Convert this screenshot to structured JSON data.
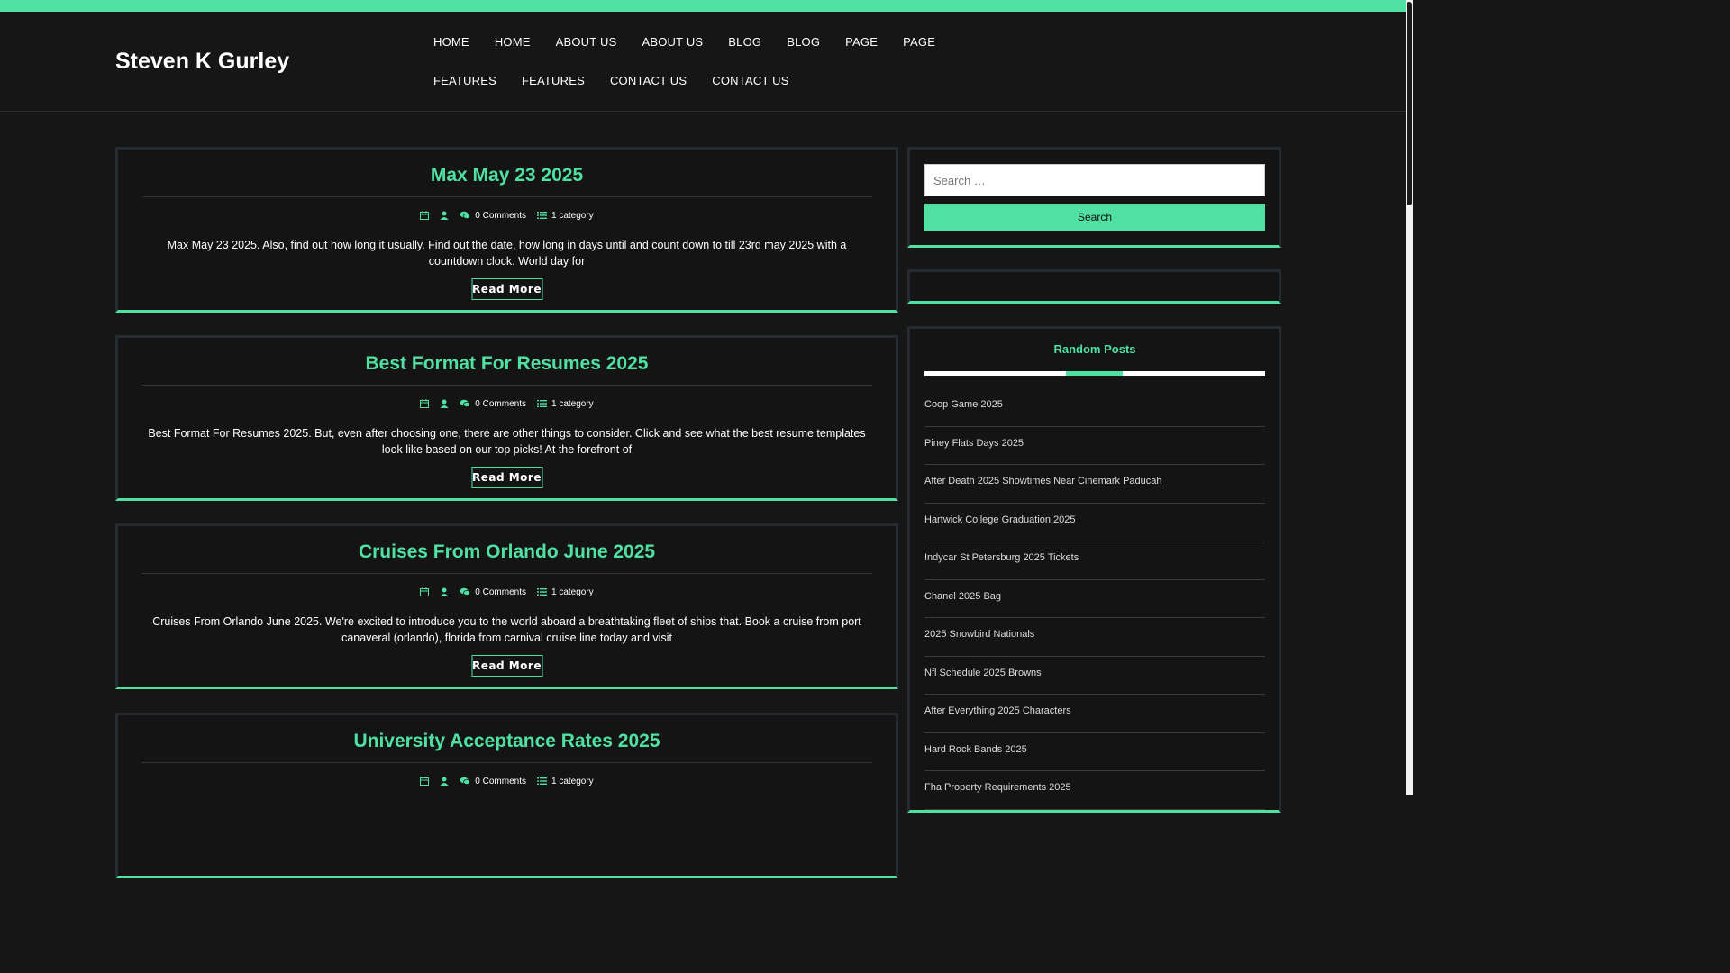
{
  "site": {
    "title": "Steven K Gurley"
  },
  "nav": {
    "items": [
      {
        "label": "HOME"
      },
      {
        "label": "HOME"
      },
      {
        "label": "ABOUT US"
      },
      {
        "label": "ABOUT US"
      },
      {
        "label": "BLOG"
      },
      {
        "label": "BLOG"
      },
      {
        "label": "PAGE"
      },
      {
        "label": "PAGE"
      },
      {
        "label": "FEATURES"
      },
      {
        "label": "FEATURES"
      },
      {
        "label": "CONTACT US"
      },
      {
        "label": "CONTACT US"
      }
    ]
  },
  "posts": [
    {
      "title": "Max May 23 2025",
      "comments": "0 Comments",
      "category": "1 category",
      "excerpt": "Max May 23 2025. Also, find out how long it usually. Find out the date, how long in days until and count down to till 23rd may 2025 with a countdown clock. World day for",
      "read_more": "Read More"
    },
    {
      "title": "Best Format For Resumes 2025",
      "comments": "0 Comments",
      "category": "1 category",
      "excerpt": "Best Format For Resumes 2025. But, even after choosing one, there are other things to consider. Click and see what the best resume templates look like based on our top picks! At the forefront of",
      "read_more": "Read More"
    },
    {
      "title": "Cruises From Orlando June 2025",
      "comments": "0 Comments",
      "category": "1 category",
      "excerpt": "Cruises From Orlando June 2025. We're excited to introduce you to the world aboard a breathtaking fleet of ships that. Book a cruise from port canaveral (orlando), florida from carnival cruise line today and visit",
      "read_more": "Read More"
    },
    {
      "title": "University Acceptance Rates 2025",
      "comments": "0 Comments",
      "category": "1 category",
      "excerpt": "",
      "read_more": ""
    }
  ],
  "sidebar": {
    "search": {
      "placeholder": "Search …",
      "button_label": "Search"
    },
    "random_posts": {
      "title": "Random Posts",
      "items": [
        "Coop Game 2025",
        "Piney Flats Days 2025",
        "After Death 2025 Showtimes Near Cinemark Paducah",
        "Hartwick College Graduation 2025",
        "Indycar St Petersburg 2025 Tickets",
        "Chanel 2025 Bag",
        "2025 Snowbird Nationals",
        "Nfl Schedule 2025 Browns",
        "After Everything 2025 Characters",
        "Hard Rock Bands 2025",
        "Fha Property Requirements 2025"
      ]
    }
  },
  "colors": {
    "accent": "#4fe0a2",
    "background": "#161616",
    "panel_border": "#262b31"
  },
  "icons": {
    "date": "calendar-icon",
    "author": "user-icon",
    "comments": "comments-icon",
    "category": "list-icon"
  }
}
